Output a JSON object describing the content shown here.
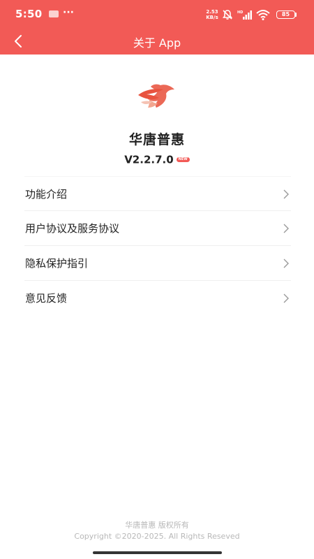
{
  "status_bar": {
    "time": "5:50",
    "more": "···",
    "net_speed": "2.53",
    "net_speed_unit": "KB/s",
    "battery": "85",
    "icons": [
      "bell-muted-icon",
      "signal-hd-icon",
      "wifi-icon",
      "battery-icon"
    ]
  },
  "nav": {
    "title": "关于 App",
    "back_icon": "chevron-left-icon"
  },
  "app": {
    "name": "华唐普惠",
    "version": "V2.2.7.0",
    "new_badge": "NEW"
  },
  "menu": {
    "items": [
      {
        "label": "功能介绍"
      },
      {
        "label": "用户协议及服务协议"
      },
      {
        "label": "隐私保护指引"
      },
      {
        "label": "意见反馈"
      }
    ]
  },
  "footer": {
    "line1": "华唐普惠 版权所有",
    "line2": "Copyright ©2020-2025. All Rights Reseved"
  },
  "colors": {
    "brand": "#f25a56",
    "text": "#222222",
    "muted": "#b8b8b8",
    "divider": "#efefef"
  }
}
